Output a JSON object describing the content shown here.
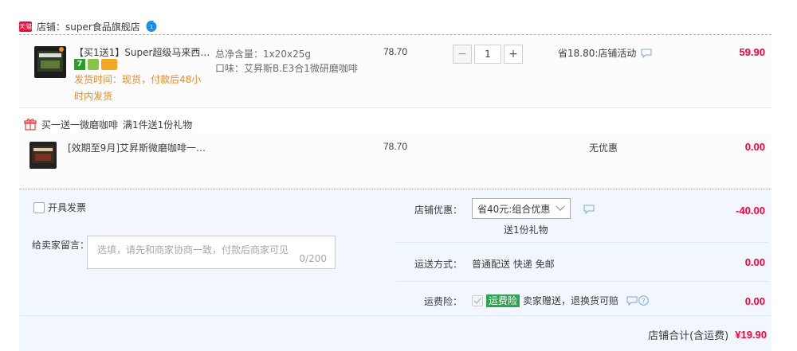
{
  "shop": {
    "badge": "天猫",
    "name": "店铺：super食品旗舰店"
  },
  "item1": {
    "title": "【买1送1】Super超级马来西…",
    "badges": [
      "7"
    ],
    "shipping": "发货时间：现货，付款后48小时内发货",
    "spec1": "总净含量：1x20x25g",
    "spec2": "口味：艾昇斯B.E3合1微研磨咖啡",
    "price": "78.70",
    "qty": "1",
    "promo": "省18.80:店铺活动",
    "total": "59.90"
  },
  "gift": {
    "label": "买一送一微磨咖啡",
    "rule": "满1件送1份礼物"
  },
  "item2": {
    "title": "[效期至9月]艾昇斯微磨咖啡一…",
    "price": "78.70",
    "promo": "无优惠",
    "total": "0.00"
  },
  "invoice": {
    "label": "开具发票"
  },
  "message": {
    "label": "给卖家留言：",
    "placeholder": "选填，请先和商家协商一致，付款后商家可见",
    "counter": "0/200"
  },
  "discount": {
    "label": "店铺优惠：",
    "selected": "省40元:组合优惠",
    "note": "送1份礼物",
    "amount": "-40.00"
  },
  "delivery": {
    "label": "运送方式：",
    "value": "普通配送 快递 免邮",
    "amount": "0.00"
  },
  "insurance": {
    "label": "运费险：",
    "tag": "运费险",
    "desc": "卖家赠送，退换货可赔",
    "amount": "0.00"
  },
  "summary": {
    "label": "店铺合计(含运费)",
    "amount": "¥19.90"
  },
  "colors": {
    "accent_red": "#ff0036",
    "orange": "#f08b27",
    "panel_bg": "#f2f7ff",
    "green_tag": "#2ea44f"
  }
}
